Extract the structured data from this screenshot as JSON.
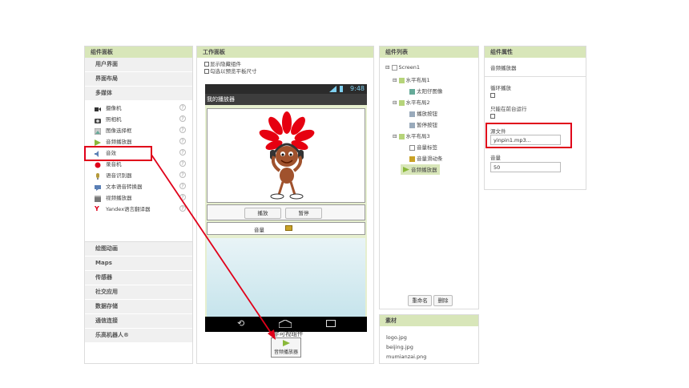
{
  "palette": {
    "title": "组件面板",
    "categories_top": [
      "用户界面",
      "界面布局",
      "多媒体"
    ],
    "media_items": [
      {
        "label": "摄像机",
        "icon": "video-camera-icon"
      },
      {
        "label": "照相机",
        "icon": "camera-icon"
      },
      {
        "label": "图像选择框",
        "icon": "image-picker-icon"
      },
      {
        "label": "音频播放器",
        "icon": "player-icon"
      },
      {
        "label": "音效",
        "icon": "sound-icon"
      },
      {
        "label": "录音机",
        "icon": "recorder-icon"
      },
      {
        "label": "语音识别器",
        "icon": "speech-recognizer-icon"
      },
      {
        "label": "文本语音转换器",
        "icon": "text-to-speech-icon"
      },
      {
        "label": "视频播放器",
        "icon": "video-player-icon"
      },
      {
        "label": "Yandex语言翻译器",
        "icon": "yandex-icon"
      }
    ],
    "help": "?",
    "categories_bottom": [
      "绘图动画",
      "Maps",
      "传感器",
      "社交应用",
      "数据存储",
      "通信连接",
      "乐高机器人®"
    ]
  },
  "viewer": {
    "title": "工作面板",
    "option1": "显示隐藏组件",
    "option2": "勾选以预览平板尺寸",
    "status_time": "9:48",
    "app_title": "我的播放器",
    "play_button": "播放",
    "pause_button": "暂停",
    "volume_label": "音量",
    "nonvisible_title": "非可视组件",
    "nonvisible_item": "音频播放器"
  },
  "components": {
    "title": "组件列表",
    "tree": [
      {
        "label": "Screen1",
        "level": 0
      },
      {
        "label": "水平布局1",
        "level": 1
      },
      {
        "label": "太阳仔图像",
        "level": 2
      },
      {
        "label": "水平布局2",
        "level": 1
      },
      {
        "label": "播放按钮",
        "level": 2
      },
      {
        "label": "暂停按钮",
        "level": 2
      },
      {
        "label": "水平布局3",
        "level": 1
      },
      {
        "label": "音量标签",
        "level": 2
      },
      {
        "label": "音量滑动条",
        "level": 2
      },
      {
        "label": "音频播放器",
        "level": 1
      }
    ],
    "rename_button": "重命名",
    "delete_button": "删除"
  },
  "media": {
    "title": "素材",
    "files": [
      "logo.jpg",
      "beijing.jpg",
      "mumianzai.png"
    ]
  },
  "properties": {
    "title": "组件属性",
    "component_name": "音频播放器",
    "loop_label": "循环播放",
    "foreground_label": "只能在前台运行",
    "source_label": "源文件",
    "source_value": "yinpin1.mp3...",
    "volume_label": "音量",
    "volume_value": "50"
  },
  "colors": {
    "header_bg": "#d8e6b9",
    "highlight_red": "#e0001a",
    "phone_bar": "#2b2b2b",
    "viewer_bg": "#e6efcf",
    "selected_item": "#d8e6b9"
  }
}
